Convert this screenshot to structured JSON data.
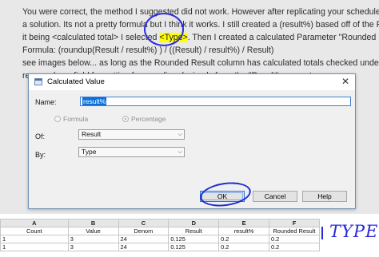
{
  "post": {
    "lines": [
      "You were correct, the method I suggested did not work. However after replicating your schedule I thin",
      "a solution. Its not a pretty formula but I think it works. I still created a (result%) based off of the Resu",
      "it being <calculated total> I selected",
      "<Type>",
      ". Then I created a calculated Parameter \"Rounded Result\"",
      "Formula: (roundup(Result / result%) ) / ((Result) / result%) / Result)",
      "see images below... as long as the Rounded Result column has calculated totals checked under Field Fo",
      "removed any field formatting for rounding decimals from the \"Result\" parameter."
    ]
  },
  "dialog": {
    "title": "Calculated Value",
    "close_symbol": "✕",
    "name_label": "Name:",
    "name_value": "result%",
    "radio_formula": "Formula",
    "radio_percentage": "Percentage",
    "of_label": "Of:",
    "of_value": "Result",
    "by_label": "By:",
    "by_value": "Type",
    "ok_label": "OK",
    "cancel_label": "Cancel",
    "help_label": "Help"
  },
  "sheet": {
    "columns": [
      "A",
      "B",
      "C",
      "D",
      "E",
      "F"
    ],
    "headers": [
      "Count",
      "Value",
      "Denom",
      "Result",
      "result%",
      "Rounded Result"
    ],
    "rows": [
      [
        "1",
        "3",
        "24",
        "0.125",
        "0.2",
        "0.2"
      ],
      [
        "1",
        "3",
        "24",
        "0.125",
        "0.2",
        "0.2"
      ]
    ]
  },
  "annotation": {
    "handwritten_text": "TYPE?"
  },
  "colors": {
    "annotation_blue": "#2a2ad8",
    "highlight_yellow": "#ffff00",
    "selection_blue": "#0f6fd8"
  }
}
